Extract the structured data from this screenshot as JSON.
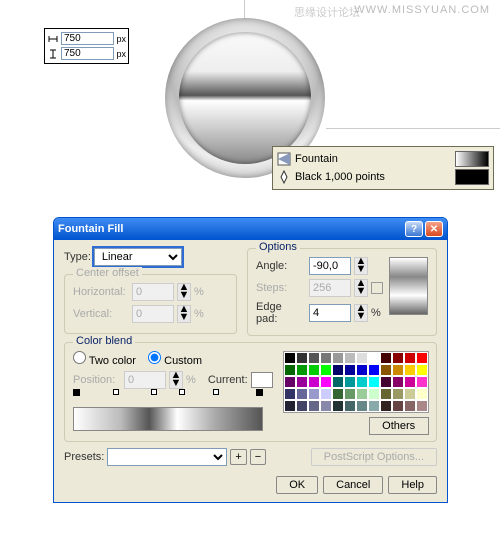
{
  "watermark": {
    "cn": "思缘设计论坛",
    "en": "WWW.MISSYUAN.COM"
  },
  "dimensions": {
    "w_value": "750",
    "h_value": "750",
    "unit": "px"
  },
  "info": {
    "fill_type": "Fountain",
    "outline": "Black  1,000 points"
  },
  "dialog": {
    "title": "Fountain Fill",
    "type_label": "Type:",
    "type_value": "Linear",
    "center_offset_label": "Center offset",
    "horizontal_label": "Horizontal:",
    "horizontal_value": "0",
    "vertical_label": "Vertical:",
    "vertical_value": "0",
    "percent": "%",
    "options_label": "Options",
    "angle_label": "Angle:",
    "angle_value": "-90,0",
    "steps_label": "Steps:",
    "steps_value": "256",
    "edgepad_label": "Edge pad:",
    "edgepad_value": "4",
    "colorblend_label": "Color blend",
    "two_color_label": "Two color",
    "custom_label": "Custom",
    "position_label": "Position:",
    "position_value": "0",
    "current_label": "Current:",
    "others_label": "Others",
    "presets_label": "Presets:",
    "presets_value": "",
    "postscript_label": "PostScript Options...",
    "ok": "OK",
    "cancel": "Cancel",
    "help": "Help"
  },
  "palette_colors": [
    "#000",
    "#333",
    "#555",
    "#777",
    "#999",
    "#bbb",
    "#ddd",
    "#fff",
    "#400",
    "#800",
    "#c00",
    "#f00",
    "#060",
    "#090",
    "#0c0",
    "#0f0",
    "#006",
    "#009",
    "#00c",
    "#00f",
    "#850",
    "#c80",
    "#fc0",
    "#ff0",
    "#606",
    "#909",
    "#c0c",
    "#f0f",
    "#066",
    "#099",
    "#0cc",
    "#0ff",
    "#403",
    "#806",
    "#c09",
    "#f3c",
    "#336",
    "#669",
    "#99c",
    "#ccf",
    "#363",
    "#696",
    "#9c9",
    "#cfc",
    "#663",
    "#996",
    "#cc9",
    "#ffc",
    "#223",
    "#446",
    "#668",
    "#88a",
    "#233",
    "#466",
    "#688",
    "#8aa",
    "#322",
    "#644",
    "#866",
    "#a88"
  ]
}
